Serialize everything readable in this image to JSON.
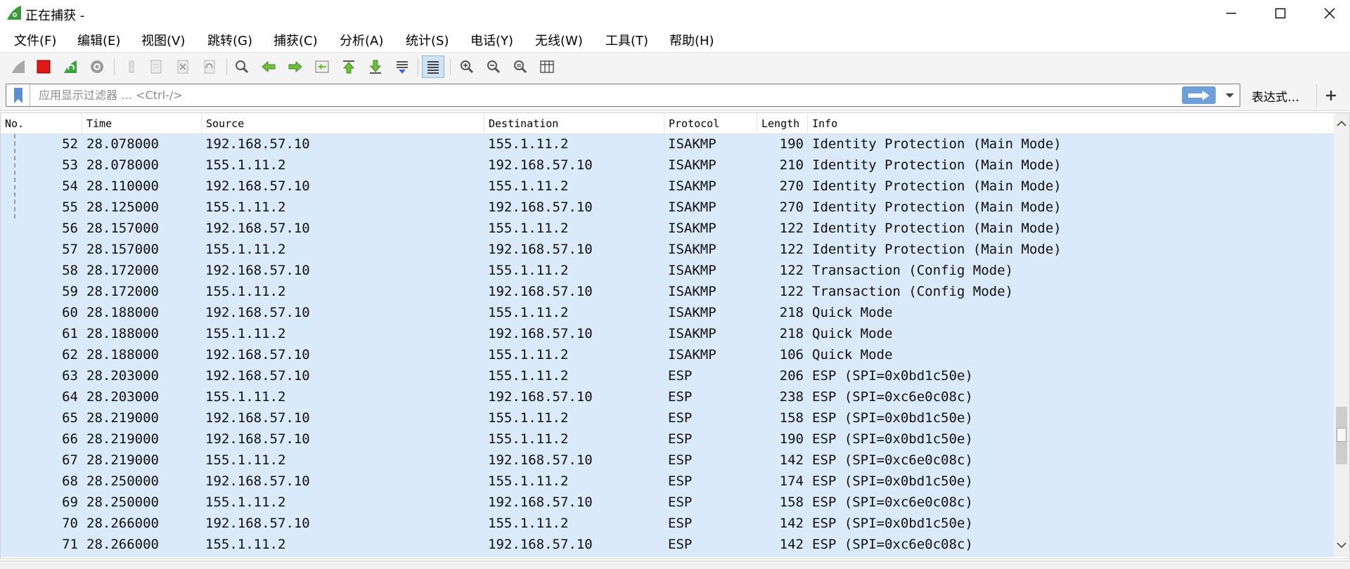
{
  "window": {
    "title": "正在捕获 -",
    "minimize_icon": "minimize-icon",
    "maximize_icon": "maximize-icon",
    "close_icon": "close-icon"
  },
  "menu": {
    "items": [
      "文件(F)",
      "编辑(E)",
      "视图(V)",
      "跳转(G)",
      "捕获(C)",
      "分析(A)",
      "统计(S)",
      "电话(Y)",
      "无线(W)",
      "工具(T)",
      "帮助(H)"
    ]
  },
  "toolbar": {
    "icons": [
      "shark-fin-start-icon",
      "stop-icon",
      "restart-icon",
      "options-gear-icon",
      "open-file-icon",
      "save-file-icon",
      "close-file-icon",
      "reload-icon",
      "find-icon",
      "back-icon",
      "forward-icon",
      "goto-packet-icon",
      "first-packet-icon",
      "last-packet-icon",
      "autoscroll-icon",
      "colorize-icon",
      "zoom-in-icon",
      "zoom-out-icon",
      "normal-size-icon",
      "resize-columns-icon"
    ]
  },
  "filter": {
    "placeholder": "应用显示过滤器 … <Ctrl-/>",
    "expression_label": "表达式…",
    "plus_label": "+"
  },
  "packet_list": {
    "columns": [
      "No.",
      "Time",
      "Source",
      "Destination",
      "Protocol",
      "Length",
      "Info"
    ],
    "rows": [
      {
        "no": "52",
        "time": "28.078000",
        "src": "192.168.57.10",
        "dst": "155.1.11.2",
        "proto": "ISAKMP",
        "len": "190",
        "info": "Identity Protection (Main Mode)"
      },
      {
        "no": "53",
        "time": "28.078000",
        "src": "155.1.11.2",
        "dst": "192.168.57.10",
        "proto": "ISAKMP",
        "len": "210",
        "info": "Identity Protection (Main Mode)"
      },
      {
        "no": "54",
        "time": "28.110000",
        "src": "192.168.57.10",
        "dst": "155.1.11.2",
        "proto": "ISAKMP",
        "len": "270",
        "info": "Identity Protection (Main Mode)"
      },
      {
        "no": "55",
        "time": "28.125000",
        "src": "155.1.11.2",
        "dst": "192.168.57.10",
        "proto": "ISAKMP",
        "len": "270",
        "info": "Identity Protection (Main Mode)"
      },
      {
        "no": "56",
        "time": "28.157000",
        "src": "192.168.57.10",
        "dst": "155.1.11.2",
        "proto": "ISAKMP",
        "len": "122",
        "info": "Identity Protection (Main Mode)"
      },
      {
        "no": "57",
        "time": "28.157000",
        "src": "155.1.11.2",
        "dst": "192.168.57.10",
        "proto": "ISAKMP",
        "len": "122",
        "info": "Identity Protection (Main Mode)"
      },
      {
        "no": "58",
        "time": "28.172000",
        "src": "192.168.57.10",
        "dst": "155.1.11.2",
        "proto": "ISAKMP",
        "len": "122",
        "info": "Transaction (Config Mode)"
      },
      {
        "no": "59",
        "time": "28.172000",
        "src": "155.1.11.2",
        "dst": "192.168.57.10",
        "proto": "ISAKMP",
        "len": "122",
        "info": "Transaction (Config Mode)"
      },
      {
        "no": "60",
        "time": "28.188000",
        "src": "192.168.57.10",
        "dst": "155.1.11.2",
        "proto": "ISAKMP",
        "len": "218",
        "info": "Quick Mode"
      },
      {
        "no": "61",
        "time": "28.188000",
        "src": "155.1.11.2",
        "dst": "192.168.57.10",
        "proto": "ISAKMP",
        "len": "218",
        "info": "Quick Mode"
      },
      {
        "no": "62",
        "time": "28.188000",
        "src": "192.168.57.10",
        "dst": "155.1.11.2",
        "proto": "ISAKMP",
        "len": "106",
        "info": "Quick Mode"
      },
      {
        "no": "63",
        "time": "28.203000",
        "src": "192.168.57.10",
        "dst": "155.1.11.2",
        "proto": "ESP",
        "len": "206",
        "info": "ESP (SPI=0x0bd1c50e)"
      },
      {
        "no": "64",
        "time": "28.203000",
        "src": "155.1.11.2",
        "dst": "192.168.57.10",
        "proto": "ESP",
        "len": "238",
        "info": "ESP (SPI=0xc6e0c08c)"
      },
      {
        "no": "65",
        "time": "28.219000",
        "src": "192.168.57.10",
        "dst": "155.1.11.2",
        "proto": "ESP",
        "len": "158",
        "info": "ESP (SPI=0x0bd1c50e)"
      },
      {
        "no": "66",
        "time": "28.219000",
        "src": "192.168.57.10",
        "dst": "155.1.11.2",
        "proto": "ESP",
        "len": "190",
        "info": "ESP (SPI=0x0bd1c50e)"
      },
      {
        "no": "67",
        "time": "28.219000",
        "src": "155.1.11.2",
        "dst": "192.168.57.10",
        "proto": "ESP",
        "len": "142",
        "info": "ESP (SPI=0xc6e0c08c)"
      },
      {
        "no": "68",
        "time": "28.250000",
        "src": "192.168.57.10",
        "dst": "155.1.11.2",
        "proto": "ESP",
        "len": "174",
        "info": "ESP (SPI=0x0bd1c50e)"
      },
      {
        "no": "69",
        "time": "28.250000",
        "src": "155.1.11.2",
        "dst": "192.168.57.10",
        "proto": "ESP",
        "len": "158",
        "info": "ESP (SPI=0xc6e0c08c)"
      },
      {
        "no": "70",
        "time": "28.266000",
        "src": "192.168.57.10",
        "dst": "155.1.11.2",
        "proto": "ESP",
        "len": "142",
        "info": "ESP (SPI=0x0bd1c50e)"
      },
      {
        "no": "71",
        "time": "28.266000",
        "src": "155.1.11.2",
        "dst": "192.168.57.10",
        "proto": "ESP",
        "len": "142",
        "info": "ESP (SPI=0xc6e0c08c)"
      }
    ]
  },
  "colors": {
    "row_background": "#dbeafb",
    "apply_button": "#6d9fd8"
  }
}
